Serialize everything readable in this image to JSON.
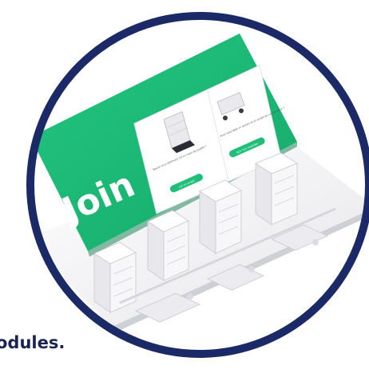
{
  "hero": {
    "brand_word": "Join",
    "colors": {
      "ring": "#1b2a66",
      "screen": "#1fbf7a",
      "panel": "#ffffff",
      "city": "#f2f2f4"
    },
    "left_panel": {
      "text": "Besoin d'un bâtiment clé en main de qualité ?",
      "button": "J'ai un projet"
    },
    "right_panel": {
      "text": "Vous avez déjà un terrain et un projet de construction ?",
      "button": "Voir nos modules"
    }
  },
  "caption": "odules."
}
